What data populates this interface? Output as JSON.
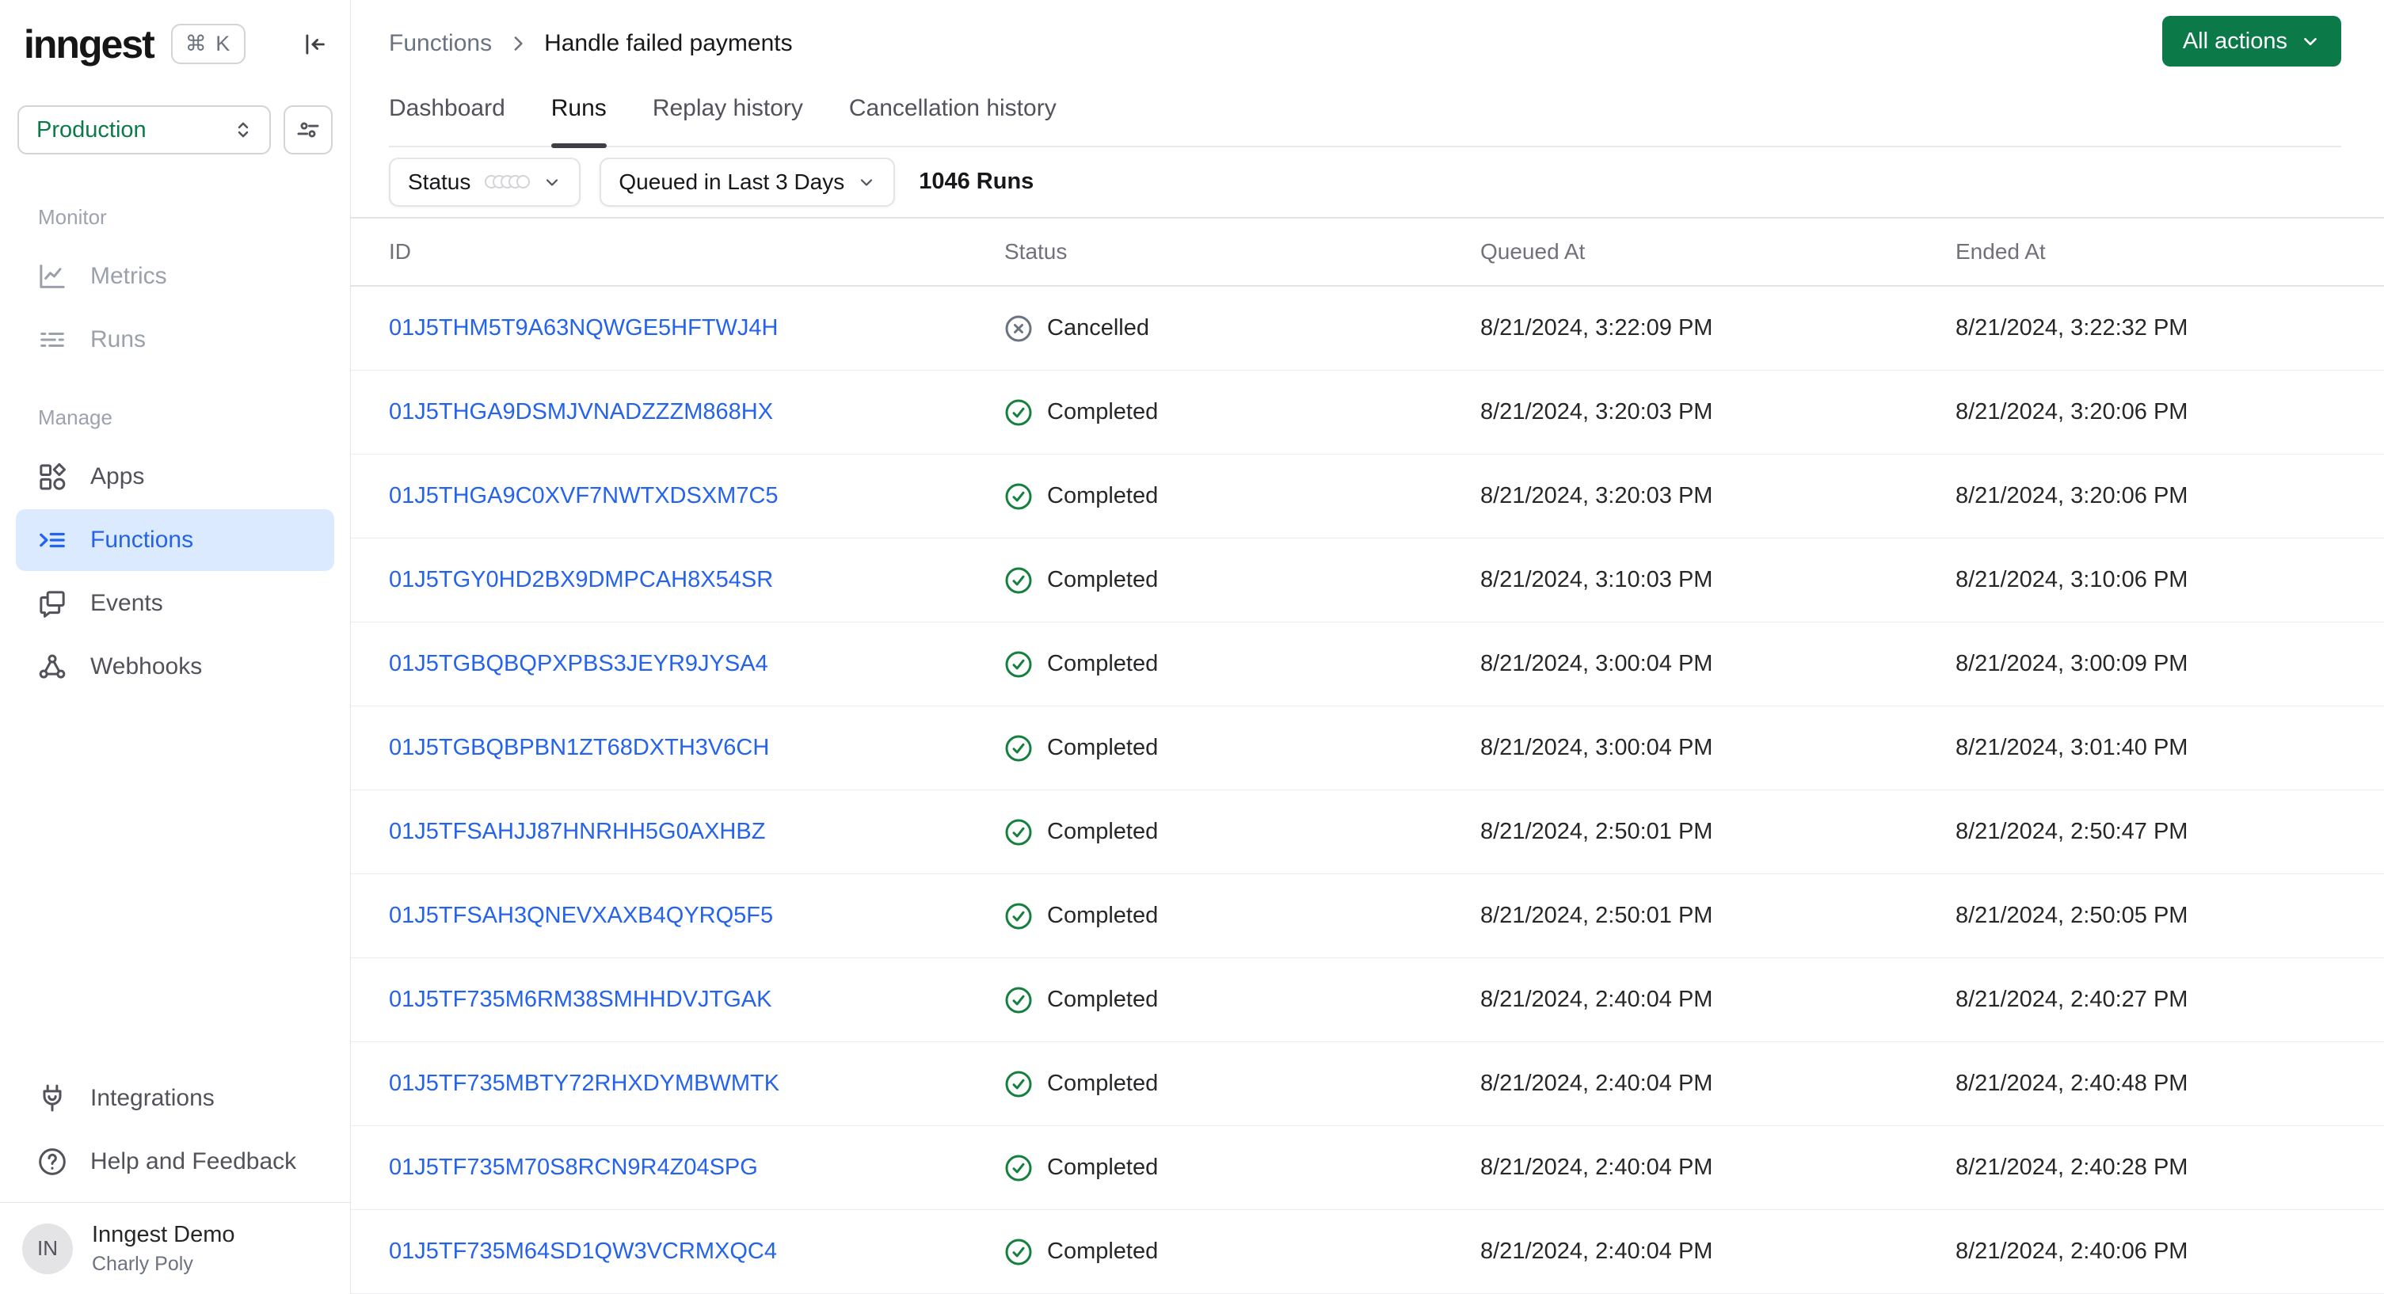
{
  "sidebar": {
    "logo": "inngest",
    "shortcut": "⌘ K",
    "env_selector": {
      "value": "Production"
    },
    "sections": [
      {
        "label": "Monitor",
        "items": [
          {
            "label": "Metrics"
          },
          {
            "label": "Runs"
          }
        ]
      },
      {
        "label": "Manage",
        "items": [
          {
            "label": "Apps"
          },
          {
            "label": "Functions",
            "active": true
          },
          {
            "label": "Events"
          },
          {
            "label": "Webhooks"
          }
        ]
      }
    ],
    "footer_items": [
      {
        "label": "Integrations"
      },
      {
        "label": "Help and Feedback"
      }
    ],
    "user": {
      "initials": "IN",
      "org": "Inngest Demo",
      "name": "Charly Poly"
    }
  },
  "header": {
    "breadcrumb": {
      "parent": "Functions",
      "current": "Handle failed payments"
    },
    "tabs": [
      {
        "label": "Dashboard"
      },
      {
        "label": "Runs",
        "active": true
      },
      {
        "label": "Replay history"
      },
      {
        "label": "Cancellation history"
      }
    ],
    "actions_button": "All actions"
  },
  "filters": {
    "status_label": "Status",
    "time_filter": "Queued in Last 3 Days",
    "runs_count": "1046 Runs"
  },
  "table": {
    "columns": {
      "id": "ID",
      "status": "Status",
      "queued_at": "Queued At",
      "ended_at": "Ended At"
    },
    "rows": [
      {
        "id": "01J5THM5T9A63NQWGE5HFTWJ4H",
        "status": "Cancelled",
        "queued_at": "8/21/2024, 3:22:09 PM",
        "ended_at": "8/21/2024, 3:22:32 PM"
      },
      {
        "id": "01J5THGA9DSMJVNADZZZM868HX",
        "status": "Completed",
        "queued_at": "8/21/2024, 3:20:03 PM",
        "ended_at": "8/21/2024, 3:20:06 PM"
      },
      {
        "id": "01J5THGA9C0XVF7NWTXDSXM7C5",
        "status": "Completed",
        "queued_at": "8/21/2024, 3:20:03 PM",
        "ended_at": "8/21/2024, 3:20:06 PM"
      },
      {
        "id": "01J5TGY0HD2BX9DMPCAH8X54SR",
        "status": "Completed",
        "queued_at": "8/21/2024, 3:10:03 PM",
        "ended_at": "8/21/2024, 3:10:06 PM"
      },
      {
        "id": "01J5TGBQBQPXPBS3JEYR9JYSA4",
        "status": "Completed",
        "queued_at": "8/21/2024, 3:00:04 PM",
        "ended_at": "8/21/2024, 3:00:09 PM"
      },
      {
        "id": "01J5TGBQBPBN1ZT68DXTH3V6CH",
        "status": "Completed",
        "queued_at": "8/21/2024, 3:00:04 PM",
        "ended_at": "8/21/2024, 3:01:40 PM"
      },
      {
        "id": "01J5TFSAHJJ87HNRHH5G0AXHBZ",
        "status": "Completed",
        "queued_at": "8/21/2024, 2:50:01 PM",
        "ended_at": "8/21/2024, 2:50:47 PM"
      },
      {
        "id": "01J5TFSAH3QNEVXAXB4QYRQ5F5",
        "status": "Completed",
        "queued_at": "8/21/2024, 2:50:01 PM",
        "ended_at": "8/21/2024, 2:50:05 PM"
      },
      {
        "id": "01J5TF735M6RM38SMHHDVJTGAK",
        "status": "Completed",
        "queued_at": "8/21/2024, 2:40:04 PM",
        "ended_at": "8/21/2024, 2:40:27 PM"
      },
      {
        "id": "01J5TF735MBTY72RHXDYMBWMTK",
        "status": "Completed",
        "queued_at": "8/21/2024, 2:40:04 PM",
        "ended_at": "8/21/2024, 2:40:48 PM"
      },
      {
        "id": "01J5TF735M70S8RCN9R4Z04SPG",
        "status": "Completed",
        "queued_at": "8/21/2024, 2:40:04 PM",
        "ended_at": "8/21/2024, 2:40:28 PM"
      },
      {
        "id": "01J5TF735M64SD1QW3VCRMXQC4",
        "status": "Completed",
        "queued_at": "8/21/2024, 2:40:04 PM",
        "ended_at": "8/21/2024, 2:40:06 PM"
      }
    ]
  },
  "colors": {
    "accent_green": "#0b7a48",
    "success_green": "#15803d",
    "link_blue": "#2563eb",
    "active_item_bg": "#dbeafe",
    "cancelled_gray": "#6b7280",
    "border": "#e4e4e7"
  }
}
